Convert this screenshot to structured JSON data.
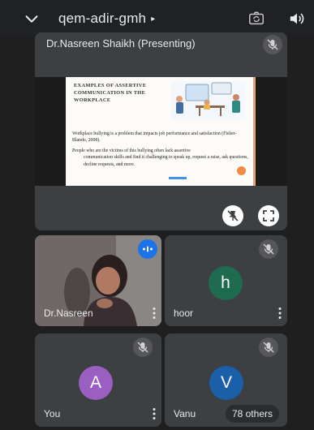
{
  "header": {
    "meeting_code": "qem-adir-gmh",
    "code_arrow": "▸"
  },
  "presenting": {
    "title": "Dr.Nasreen Shaikh (Presenting)",
    "slide": {
      "title": "EXAMPLES OF ASSERTIVE COMMUNICATION IN THE WORKPLACE",
      "paragraph1": "Workplace bullying is a problem that impacts job performance and satisfaction (Fisher-Blando, 2008).",
      "paragraph2_first": "People who are the victims of this bullying often lack assertive",
      "paragraph2_rest": "communication skills and find it challenging to speak up, request a raise, ask questions, decline requests, and more."
    }
  },
  "participants": [
    {
      "name": "Dr.Nasreen",
      "type": "video",
      "speaking": true
    },
    {
      "name": "hoor",
      "initial": "h",
      "avatar_color": "#1e6b50",
      "muted": true
    },
    {
      "name": "You",
      "initial": "A",
      "avatar_color": "#9a5fc0",
      "muted": true
    },
    {
      "name": "Vanu",
      "initial": "V",
      "avatar_color": "#1a5fa8",
      "muted": true,
      "others_label": "78 others"
    }
  ],
  "colors": {
    "background": "#1f1f1f",
    "tile": "#3c4043",
    "accent": "#1a73e8"
  },
  "icons": [
    "chevron-down-icon",
    "camera-switch-icon",
    "speaker-icon",
    "mic-off-icon",
    "pin-off-icon",
    "fullscreen-icon",
    "more-vert-icon",
    "audio-level-icon"
  ]
}
